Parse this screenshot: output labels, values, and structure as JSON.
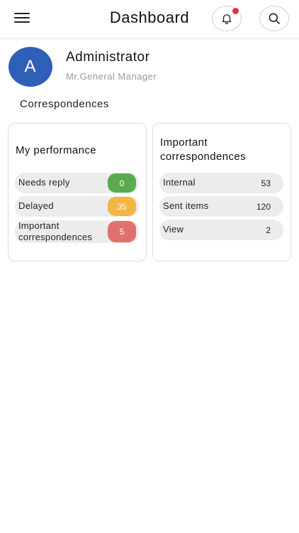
{
  "header": {
    "title": "Dashboard"
  },
  "profile": {
    "initial": "A",
    "name": "Administrator",
    "role": "Mr.General Manager"
  },
  "section": {
    "title": "Correspondences"
  },
  "performance": {
    "title": "My performance",
    "items": [
      {
        "label": "Needs reply",
        "count": "0",
        "color": "#5aaa4f"
      },
      {
        "label": "Delayed",
        "count": "35",
        "color": "#f4b63f"
      },
      {
        "label": "Important\ncorrespondences",
        "count": "5",
        "color": "#e3706d"
      }
    ]
  },
  "important": {
    "title": "Important\ncorrespondences",
    "items": [
      {
        "label": "Internal",
        "count": "53"
      },
      {
        "label": "Sent items",
        "count": "120"
      },
      {
        "label": "View",
        "count": "2"
      }
    ]
  },
  "colors": {
    "accent": "#2f5fb6",
    "notification": "#d9363e"
  }
}
